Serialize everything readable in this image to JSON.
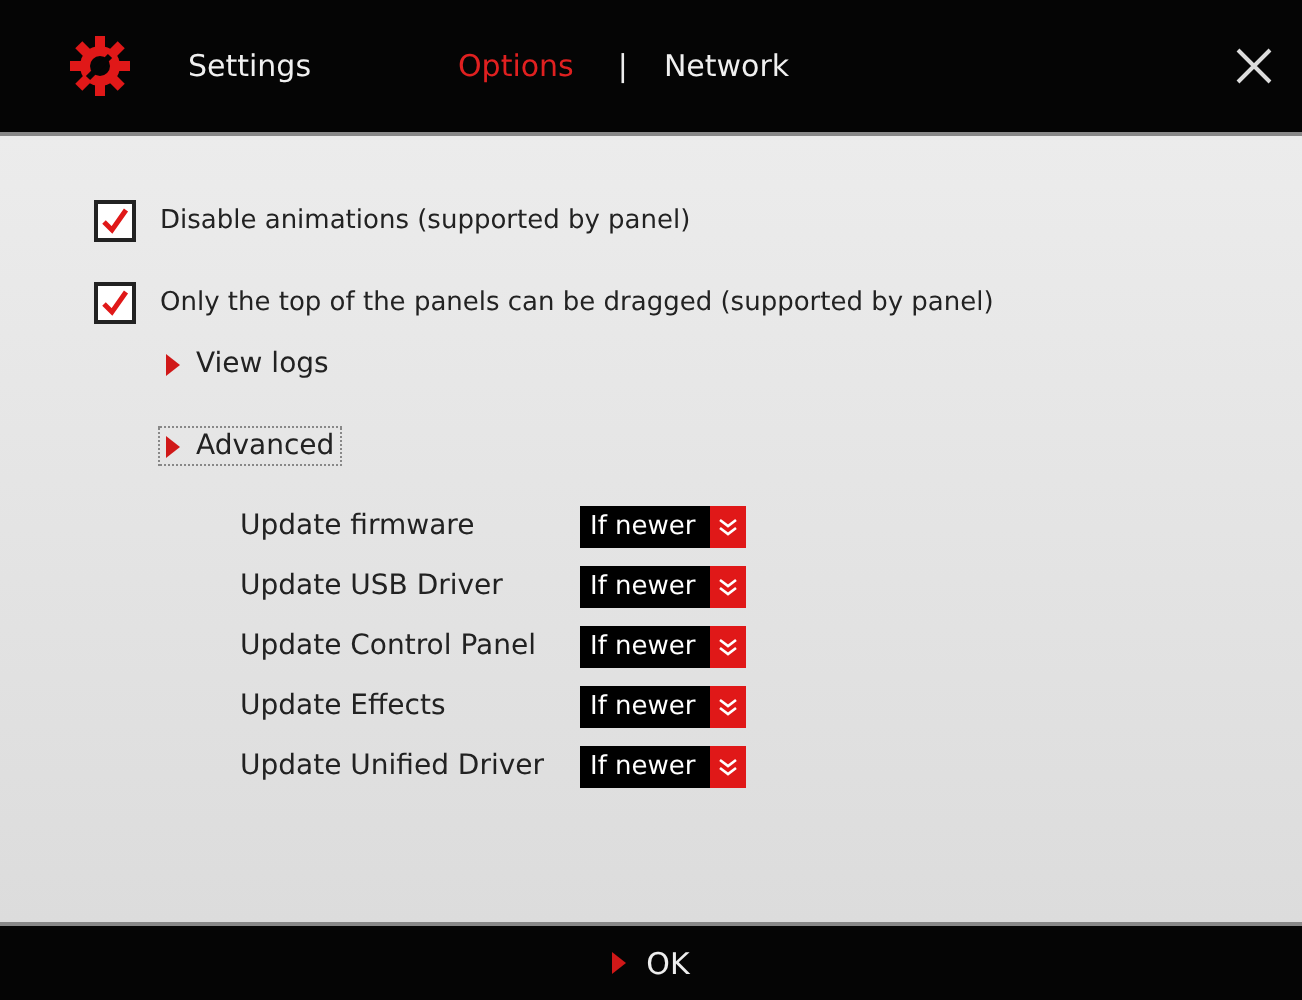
{
  "header": {
    "title": "Settings",
    "tabs": [
      {
        "label": "Options",
        "selected": true
      },
      {
        "label": "Network",
        "selected": false
      }
    ],
    "separator": "|"
  },
  "checkboxes": [
    {
      "label": "Disable animations (supported by panel)",
      "checked": true
    },
    {
      "label": "Only the top of the panels can be dragged (supported by panel)",
      "checked": true
    }
  ],
  "sections": [
    {
      "label": "View logs",
      "focused": false
    },
    {
      "label": "Advanced",
      "focused": true,
      "rows": [
        {
          "label": "Update firmware",
          "value": "If newer"
        },
        {
          "label": "Update USB Driver",
          "value": "If newer"
        },
        {
          "label": "Update Control Panel",
          "value": "If newer"
        },
        {
          "label": "Update Effects",
          "value": "If newer"
        },
        {
          "label": "Update Unified Driver",
          "value": "If newer"
        }
      ]
    }
  ],
  "footer": {
    "button": "OK"
  }
}
